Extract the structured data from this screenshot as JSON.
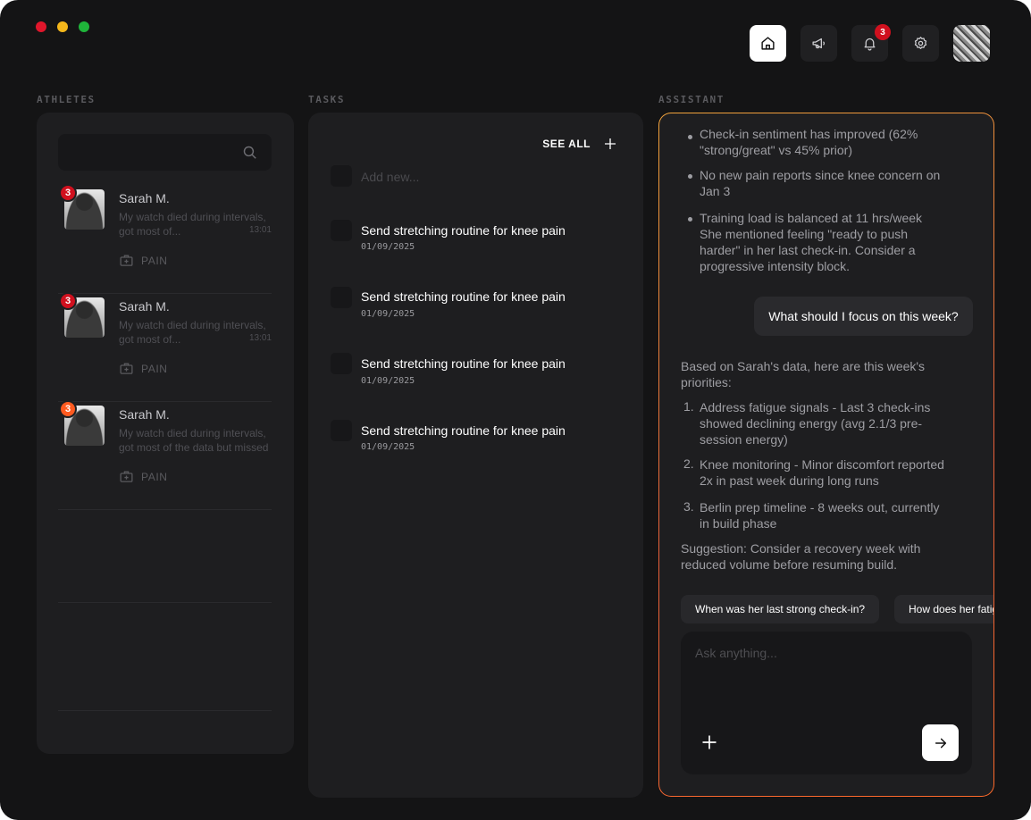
{
  "colors": {
    "traffic_red": "#e0162b",
    "traffic_yellow": "#f4b71b",
    "traffic_green": "#1fb43a",
    "badge_red": "#d0101e",
    "badge_orange": "#ff5a1f",
    "assistant_border_start": "#f2a43c",
    "assistant_border_end": "#e8603a"
  },
  "topnav": {
    "home_icon": "home-icon",
    "announce_icon": "megaphone-icon",
    "bell_icon": "bell-icon",
    "notification_count": "3",
    "settings_icon": "gear-icon"
  },
  "sections": {
    "athletes": "ATHLETES",
    "tasks": "TASKS",
    "assistant": "ASSISTANT"
  },
  "athletes": [
    {
      "badge": "3",
      "badge_color": "#d0101e",
      "name": "Sarah M.",
      "message": "My watch died during intervals, got most of...",
      "time": "13:01",
      "tag": "PAIN"
    },
    {
      "badge": "3",
      "badge_color": "#d0101e",
      "name": "Sarah M.",
      "message": "My watch died during intervals, got most of...",
      "time": "13:01",
      "tag": "PAIN"
    },
    {
      "badge": "3",
      "badge_color": "#ff5a1f",
      "name": "Sarah M.",
      "message": "My watch died during intervals, got most of the data but missed the",
      "time": "",
      "tag": "PAIN"
    }
  ],
  "tasks": {
    "see_all": "SEE ALL",
    "add_new_placeholder": "Add new...",
    "items": [
      {
        "title": "Send stretching routine for knee pain",
        "date": "01/09/2025"
      },
      {
        "title": "Send stretching routine for knee pain",
        "date": "01/09/2025"
      },
      {
        "title": "Send stretching routine for knee pain",
        "date": "01/09/2025"
      },
      {
        "title": "Send stretching routine for knee pain",
        "date": "01/09/2025"
      }
    ]
  },
  "assistant": {
    "bullets": [
      "Check-in sentiment has improved (62% \"strong/great\" vs 45% prior)",
      "No new pain reports since knee concern on Jan 3",
      "Training load is balanced at 11 hrs/week She mentioned feeling \"ready to push harder\" in her last check-in. Consider a progressive intensity block."
    ],
    "user_message": "What should I focus on this week?",
    "reply_intro": "Based on Sarah's data, here are this week's priorities:",
    "priorities": [
      {
        "num": "1.",
        "text": "Address fatigue signals - Last 3 check-ins showed declining energy (avg 2.1/3 pre-session energy)"
      },
      {
        "num": "2.",
        "text": "Knee monitoring - Minor discomfort reported 2x in past week during long runs"
      },
      {
        "num": "3.",
        "text": "Berlin prep timeline - 8 weeks out, currently in build phase"
      }
    ],
    "suggestion": "Suggestion: Consider a recovery week with reduced volume before resuming build.",
    "chips": [
      "When was her last strong check-in?",
      "How does her fatigue"
    ],
    "input_placeholder": "Ask anything..."
  }
}
